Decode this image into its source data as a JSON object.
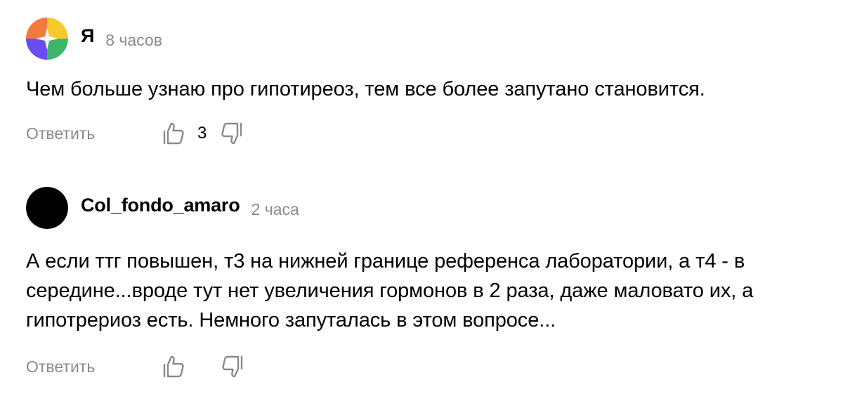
{
  "comments": [
    {
      "author": "Я",
      "time": "8 часов",
      "text": "Чем больше узнаю про гипотиреоз, тем все более запутано становится.",
      "reply_label": "Ответить",
      "likes": "3",
      "avatar_icon": "yandex-colorful-avatar-icon"
    },
    {
      "author": "Col_fondo_amaro",
      "time": "2 часа",
      "text": "А если ттг повышен, т3 на нижней границе референса лаборатории, а т4 - в середине...вроде тут нет увеличения гормонов в 2 раза, даже маловато их, а гипотрериоз есть. Немного запуталась в этом вопросе...",
      "reply_label": "Ответить",
      "likes": "",
      "avatar_icon": "black-circle-avatar-icon"
    }
  ],
  "colors": {
    "muted": "#8a8a8a",
    "text": "#000000",
    "avatar_orange": "#f47a3c",
    "avatar_yellow": "#f8c92a",
    "avatar_purple": "#6a4df0",
    "avatar_green": "#3fb56c"
  },
  "icons": {
    "like": "thumbs-up-icon",
    "dislike": "thumbs-down-icon"
  }
}
